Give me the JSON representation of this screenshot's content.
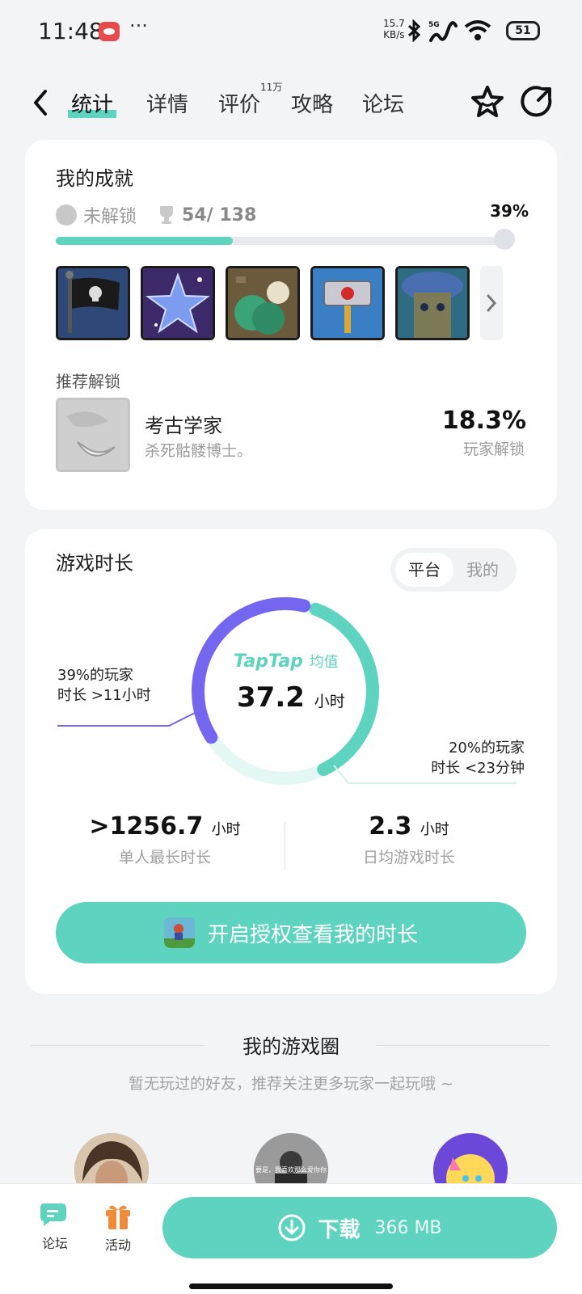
{
  "status_bar": {
    "time": "11:48",
    "dots": "···",
    "net_speed_value": "15.7",
    "net_speed_unit": "KB/s",
    "signal_label": "5G",
    "battery": "51",
    "icons": [
      "app-notification-icon",
      "bluetooth-icon",
      "signal-icon",
      "wifi-icon",
      "battery-icon"
    ]
  },
  "nav": {
    "tabs": [
      {
        "label": "统计",
        "active": true
      },
      {
        "label": "详情"
      },
      {
        "label": "评价"
      },
      {
        "label": "攻略"
      },
      {
        "label": "论坛"
      }
    ],
    "review_badge": "11万",
    "icons": [
      "back-arrow-icon",
      "star-icon",
      "share-icon"
    ]
  },
  "achievements": {
    "title": "我的成就",
    "locked_label": "未解锁",
    "count": "54/ 138",
    "percent": "39%",
    "progress": 0.39,
    "badges": [
      "pirate-flag-badge",
      "star-badge",
      "treasure-badge",
      "hammer-badge",
      "tree-badge"
    ],
    "recommend_title": "推荐解锁",
    "recommend": {
      "name": "考古学家",
      "desc": "杀死骷髅博士。",
      "percent": "18.3%",
      "percent_label": "玩家解锁"
    }
  },
  "playtime": {
    "title": "游戏时长",
    "toggle_platform": "平台",
    "toggle_mine": "我的",
    "brand": "TapTap",
    "avg_label": "均值",
    "avg_value": "37.2",
    "avg_unit": "小时",
    "left_note_1": "39%的玩家",
    "left_note_2": "时长 >11小时",
    "right_note_1": "20%的玩家",
    "right_note_2": "时长 <23分钟",
    "long_share": 0.39,
    "short_share": 0.2,
    "max_value": ">1256.7",
    "max_unit": "小时",
    "max_label": "单人最长时长",
    "daily_value": "2.3",
    "daily_unit": "小时",
    "daily_label": "日均游戏时长",
    "auth_button": "开启授权查看我的时长"
  },
  "circle": {
    "title": "我的游戏圈",
    "subtitle": "暂无玩过的好友，推荐关注更多玩家一起玩哦 ~",
    "avatar_caption": "要是，我喜欢那么爱你你"
  },
  "bottom": {
    "forum": "论坛",
    "activity": "活动",
    "download": "下载",
    "size": "366 MB"
  },
  "colors": {
    "accent": "#5ed3bf",
    "purple": "#7466ee",
    "light_teal": "#e3f7f4"
  }
}
